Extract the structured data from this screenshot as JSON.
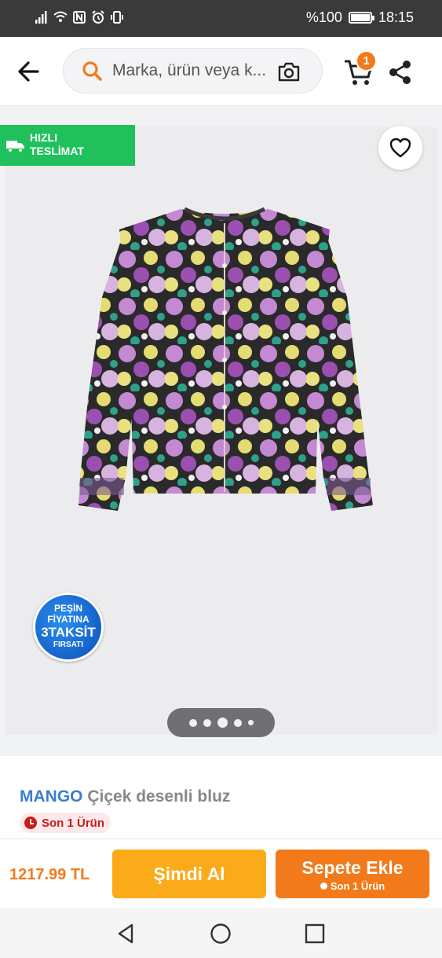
{
  "status_bar": {
    "battery": "%100",
    "time": "18:15",
    "icons": [
      "signal-icon",
      "wifi-icon",
      "nfc-icon",
      "alarm-icon",
      "vibrate-icon",
      "battery-icon"
    ]
  },
  "header": {
    "search_placeholder": "Marka, ürün veya k...",
    "cart_count": "1",
    "icons": [
      "back-arrow-icon",
      "search-icon",
      "camera-icon",
      "cart-icon",
      "share-icon"
    ]
  },
  "gallery": {
    "fast_delivery_line1": "HIZLI",
    "fast_delivery_line2": "TESLİMAT",
    "fast_delivery_color": "#20c05c",
    "installment_badge": {
      "line1": "PEŞİN",
      "line2": "FİYATINA",
      "line3": "3TAKSİT",
      "line4": "FIRSATI"
    },
    "image_count": 5,
    "active_image_index": 2
  },
  "product": {
    "brand": "MANGO",
    "name": "Çiçek desenli bluz",
    "stock_badge": "Son 1 Ürün"
  },
  "action_bar": {
    "price": "1217.99 TL",
    "buy_now_label": "Şimdi Al",
    "add_to_cart_label": "Sepete Ekle",
    "add_to_cart_sub": "Son 1 Ürün",
    "brand_color": "#f27a1a",
    "buy_now_color": "#fbaa19"
  },
  "nav_bar": {
    "icons": [
      "nav-back-icon",
      "nav-home-icon",
      "nav-recents-icon"
    ]
  }
}
